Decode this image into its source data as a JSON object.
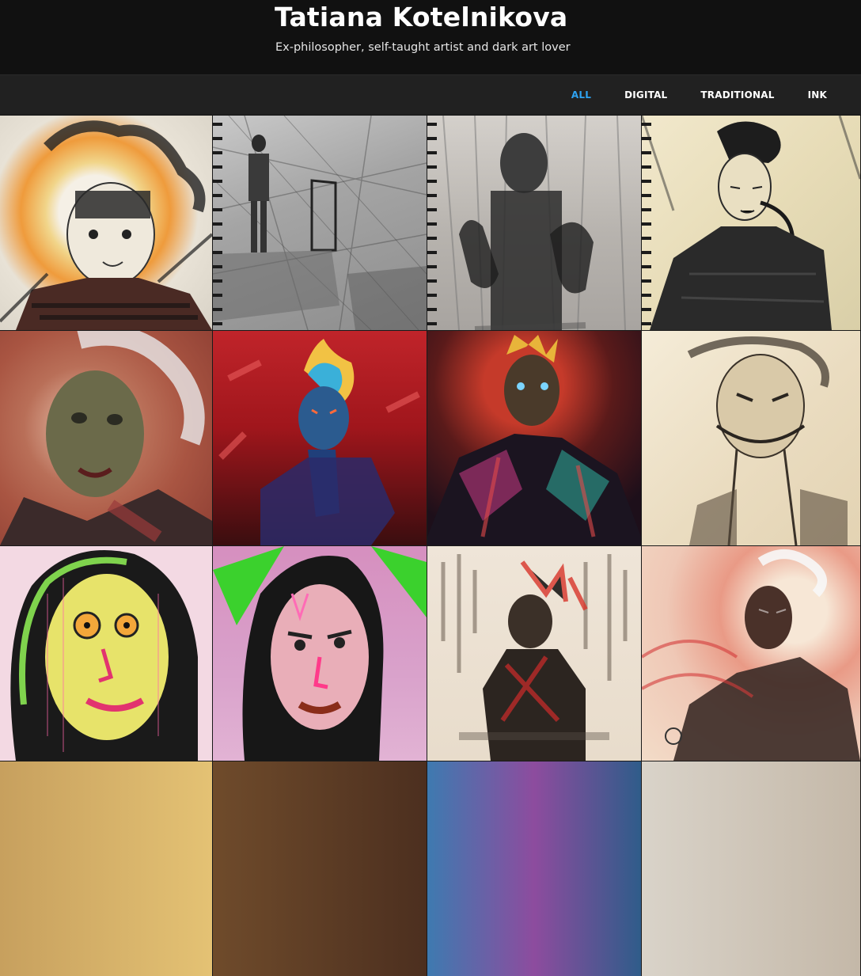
{
  "header": {
    "title": "Tatiana Kotelnikova",
    "tagline": "Ex-philosopher, self-taught artist and dark art lover"
  },
  "filters": [
    {
      "label": "ALL",
      "active": true
    },
    {
      "label": "DIGITAL",
      "active": false
    },
    {
      "label": "TRADITIONAL",
      "active": false
    },
    {
      "label": "INK",
      "active": false
    }
  ],
  "colors": {
    "accent": "#2ea3f2",
    "header_bg": "#111111",
    "nav_bg": "#212121"
  }
}
